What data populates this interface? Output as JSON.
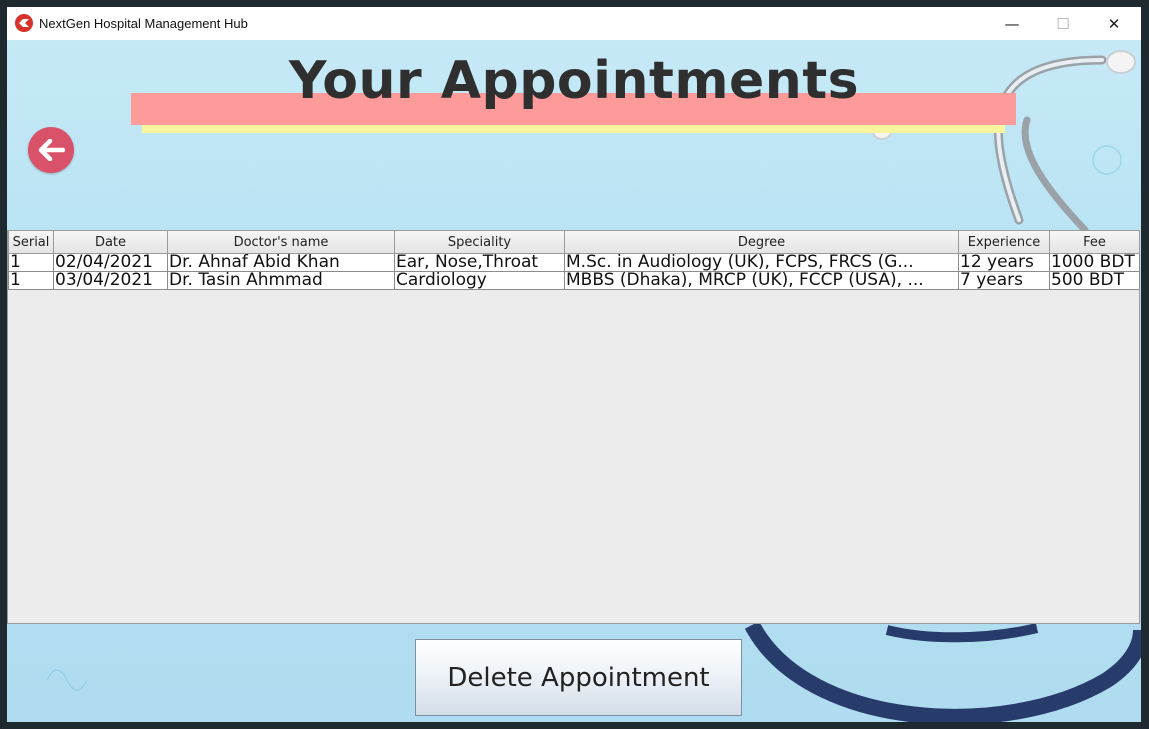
{
  "window": {
    "title": "NextGen Hospital Management Hub",
    "minimize": "—",
    "maximize": "☐",
    "close": "✕"
  },
  "header": {
    "title": "Your Appointments"
  },
  "table": {
    "columns": [
      "Serial",
      "Date",
      "Doctor's name",
      "Speciality",
      "Degree",
      "Experience",
      "Fee"
    ],
    "rows": [
      [
        "1",
        "02/04/2021",
        "Dr. Ahnaf Abid Khan",
        "Ear, Nose,Throat",
        "M.Sc. in Audiology (UK), FCPS,  FRCS (G...",
        "12 years",
        "1000 BDT"
      ],
      [
        "1",
        "03/04/2021",
        "Dr. Tasin Ahmmad",
        "Cardiology",
        "MBBS (Dhaka), MRCP (UK), FCCP (USA), ...",
        "7  years",
        "500 BDT"
      ]
    ]
  },
  "actions": {
    "delete_label": "Delete Appointment"
  },
  "icons": {
    "app": "hospital-logo-icon",
    "back": "arrow-left-icon"
  },
  "colors": {
    "title_highlight": "#fc9b99",
    "title_underline": "#f7f59e",
    "back_button": "#d9526a",
    "background": "#b5e1f3"
  }
}
